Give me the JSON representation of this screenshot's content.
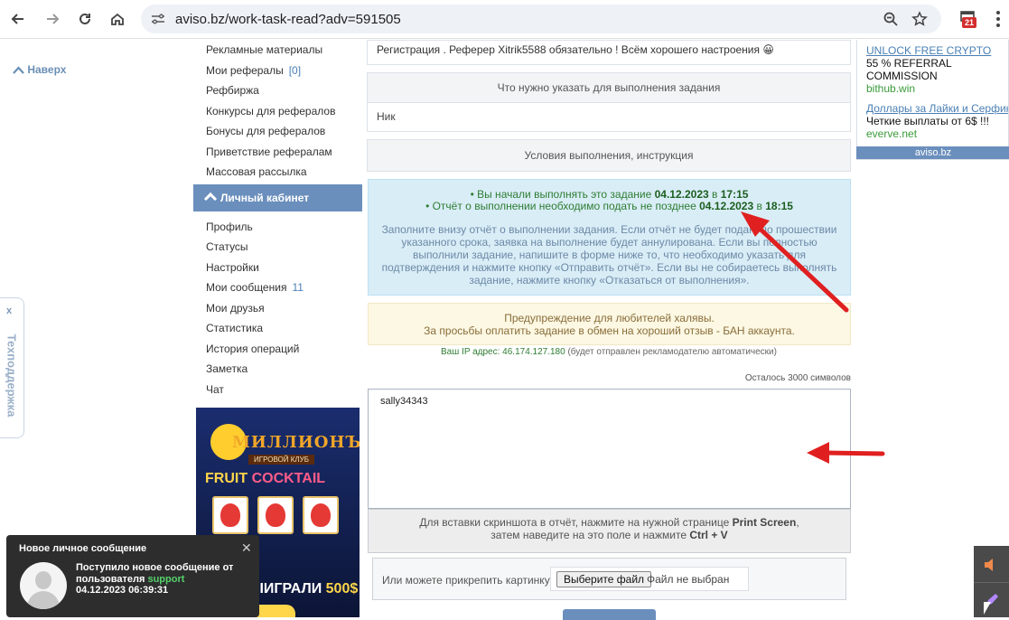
{
  "browser": {
    "url": "aviso.bz/work-task-read?adv=591505",
    "extension_badge": "21"
  },
  "page": {
    "back_to_top": "Наверх",
    "support_tab": "Техподдержка",
    "support_close": "x"
  },
  "sidebar": {
    "items_top": [
      {
        "label": "Рекламные материалы",
        "count": ""
      },
      {
        "label": "Мои рефералы",
        "count": "[0]"
      },
      {
        "label": "Рефбиржа",
        "count": ""
      },
      {
        "label": "Конкурсы для рефералов",
        "count": ""
      },
      {
        "label": "Бонусы для рефералов",
        "count": ""
      },
      {
        "label": "Приветствие рефералам",
        "count": ""
      },
      {
        "label": "Массовая рассылка",
        "count": ""
      }
    ],
    "section_header": "Личный кабинет",
    "items_cabinet": [
      {
        "label": "Профиль",
        "count": ""
      },
      {
        "label": "Статусы",
        "count": ""
      },
      {
        "label": "Настройки",
        "count": ""
      },
      {
        "label": "Мои сообщения",
        "count": "11"
      },
      {
        "label": "Мои друзья",
        "count": ""
      },
      {
        "label": "Статистика",
        "count": ""
      },
      {
        "label": "История операций",
        "count": ""
      },
      {
        "label": "Заметка",
        "count": ""
      },
      {
        "label": "Чат",
        "count": ""
      }
    ]
  },
  "banner": {
    "title": "МИЛЛИОНЪ",
    "subtitle": "ИГРОВОЙ КЛУБ",
    "fruit": "FRUIT",
    "cocktail": "COCKTAIL",
    "win_prefix": "ВЫ ВЫИГРАЛИ",
    "win_amount": "500$"
  },
  "task": {
    "description": "Регистрация . Реферер Xitrik5588 обязательно ! Всём хорошего настроения 😀",
    "what_to_specify_header": "Что нужно указать для выполнения задания",
    "what_to_specify_value": "Ник",
    "conditions_header": "Условия выполнения, инструкция",
    "started_prefix": "• Вы начали выполнять это задание",
    "started_date": "04.12.2023",
    "started_in": "в",
    "started_time": "17:15",
    "deadline_prefix": "• Отчёт о выполнении необходимо подать не позднее",
    "deadline_date": "04.12.2023",
    "deadline_in": "в",
    "deadline_time": "18:15",
    "instructions": "Заполните внизу отчёт о выполнении задания. Если отчёт не будет подан, по прошествии указанного срока, заявка на выполнение будет аннулирована. Если вы полностью выполнили задание, напишите в форме ниже то, что необходимо указать для подтверждения и нажмите кнопку «Отправить отчёт». Если вы не собираетесь выполнять задание, нажмите кнопку «Отказаться от выполнения».",
    "warning_line1": "Предупреждение для любителей халявы.",
    "warning_line2": "За просьбы оплатить задание в обмен на хороший отзыв - БАН аккаунта.",
    "ip_label": "Ваш IP адрес: 46.174.127.180",
    "ip_note": "(будет отправлен рекламодателю автоматически)",
    "remaining": "Осталось 3000 символов",
    "report_value": "sally34343",
    "screenshot_line1_prefix": "Для вставки скриншота в отчёт, нажмите на нужной странице",
    "screenshot_key1": "Print Screen",
    "screenshot_line2_prefix": "затем наведите на это поле и нажмите",
    "screenshot_key2": "Ctrl + V",
    "attach_label": "Или можете прикрепить картинку",
    "file_button": "Выберите файл",
    "file_status": "Файл не выбран"
  },
  "ad": {
    "link1": "UNLOCK FREE CRYPTO",
    "desc1": "55 % REFERRAL COMMISSION",
    "host1": "bithub.win",
    "link2": "Доллары за Лайки и Серфинг",
    "desc2": "Четкие выплаты от 6$ !!!",
    "host2": "everve.net",
    "footer": "aviso.bz"
  },
  "notification": {
    "title": "Новое личное сообщение",
    "close": "✕",
    "line_prefix": "Поступило новое сообщение от пользователя",
    "user": "support",
    "datetime": "04.12.2023 06:39:31"
  },
  "colors": {
    "accent": "#6b8fbd",
    "info_bg": "#d9edf7",
    "warning_bg": "#fcf8e3",
    "arrow": "#e02020"
  }
}
